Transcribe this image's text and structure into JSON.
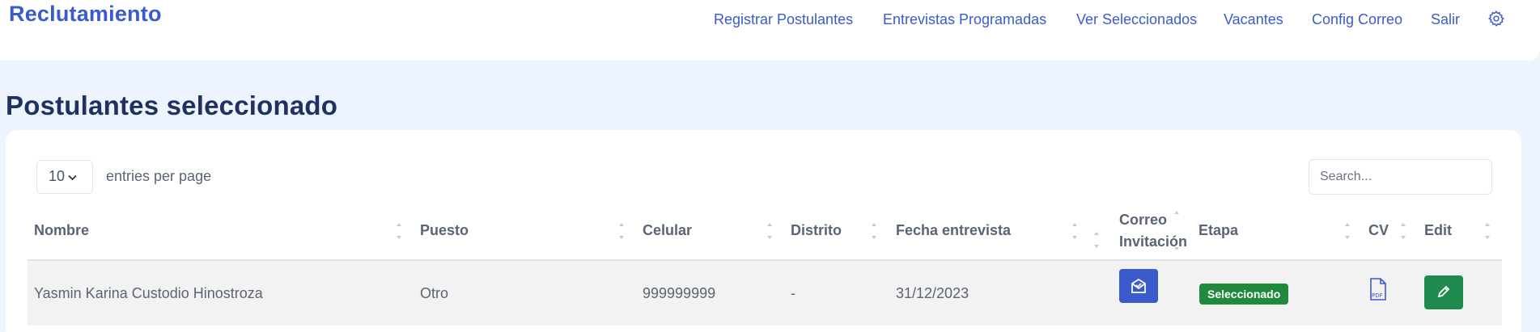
{
  "nav": {
    "brand": "Reclutamiento",
    "links": [
      "Registrar Postulantes",
      "Entrevistas Programadas",
      "Ver Seleccionados",
      "Vacantes",
      "Config Correo",
      "Salir"
    ],
    "settings_icon": "gear-icon"
  },
  "page": {
    "title": "Postulantes seleccionado"
  },
  "table_controls": {
    "entries_value": "10",
    "entries_label": "entries per page",
    "search_placeholder": "Search..."
  },
  "table": {
    "columns": [
      "Nombre",
      "Puesto",
      "Celular",
      "Distrito",
      "Fecha entrevista",
      "Correo",
      "Invitación",
      "Etapa",
      "CV",
      "Edit"
    ],
    "rows": [
      {
        "nombre": "Yasmin Karina Custodio Hinostroza",
        "puesto": "Otro",
        "celular": "999999999",
        "distrito": "-",
        "fecha": "31/12/2023",
        "correo_icon": "envelope-icon",
        "etapa": "Seleccionado",
        "cv_icon": "pdf-icon",
        "edit_icon": "pencil-icon"
      }
    ]
  },
  "colors": {
    "brand": "#3b5bcc",
    "title": "#1e3160",
    "background": "#eef4fd",
    "badge_green": "#1f8a3b",
    "edit_green": "#1f8a4d"
  }
}
